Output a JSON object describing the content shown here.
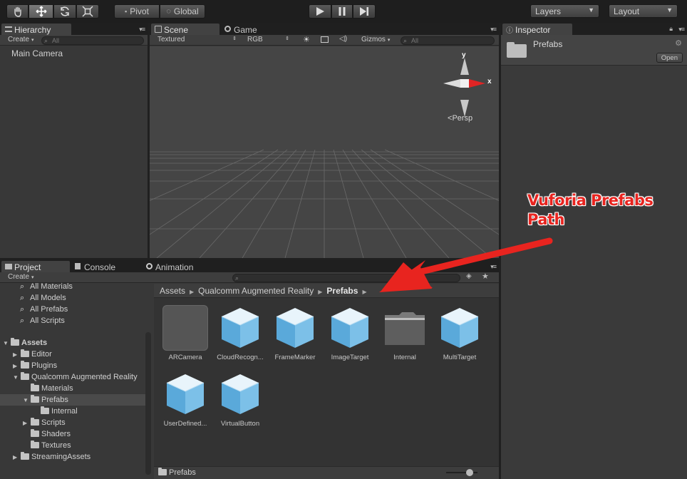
{
  "toolbar": {
    "tools": [
      "hand-tool",
      "move-tool",
      "rotate-tool",
      "scale-tool"
    ],
    "pivot_label": "Pivot",
    "global_label": "Global",
    "layers_label": "Layers",
    "layout_label": "Layout"
  },
  "hierarchy": {
    "tab_label": "Hierarchy",
    "create_label": "Create",
    "search_placeholder": "All",
    "items": [
      "Main Camera"
    ]
  },
  "scene": {
    "tab_label": "Scene",
    "game_tab_label": "Game",
    "render_mode": "Textured",
    "color_mode": "RGB",
    "gizmos_label": "Gizmos",
    "search_placeholder": "All",
    "gizmo_y": "y",
    "gizmo_x": "x",
    "persp_label": "Persp"
  },
  "inspector": {
    "tab_label": "Inspector",
    "object_name": "Prefabs",
    "open_label": "Open"
  },
  "project": {
    "tab_label": "Project",
    "console_tab_label": "Console",
    "animation_tab_label": "Animation",
    "create_label": "Create",
    "favorites": [
      "All Materials",
      "All Models",
      "All Prefabs",
      "All Scripts"
    ],
    "tree": {
      "assets": "Assets",
      "editor": "Editor",
      "plugins": "Plugins",
      "qualcomm": "Qualcomm Augmented Reality",
      "materials": "Materials",
      "prefabs": "Prefabs",
      "internal": "Internal",
      "scripts": "Scripts",
      "shaders": "Shaders",
      "textures": "Textures",
      "streaming": "StreamingAssets"
    },
    "breadcrumb": [
      "Assets",
      "Qualcomm Augmented Reality",
      "Prefabs"
    ],
    "assets": [
      {
        "name": "ARCamera",
        "kind": "camera"
      },
      {
        "name": "CloudRecogn...",
        "kind": "prefab"
      },
      {
        "name": "FrameMarker",
        "kind": "prefab"
      },
      {
        "name": "ImageTarget",
        "kind": "prefab"
      },
      {
        "name": "Internal",
        "kind": "folder"
      },
      {
        "name": "MultiTarget",
        "kind": "prefab"
      },
      {
        "name": "UserDefined...",
        "kind": "prefab"
      },
      {
        "name": "VirtualButton",
        "kind": "prefab"
      }
    ],
    "footer_label": "Prefabs"
  },
  "annotation": {
    "line1": "Vuforia Prefabs",
    "line2": "Path",
    "color": "#e8241f"
  }
}
